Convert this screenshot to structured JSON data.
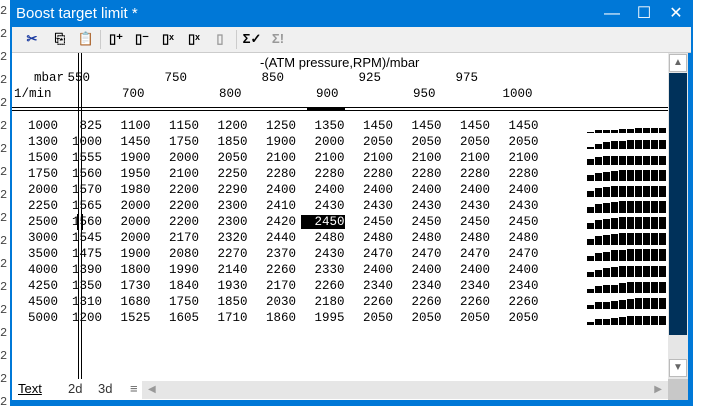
{
  "window": {
    "title": "Boost target limit  *",
    "minimize": "—",
    "maximize": "☐",
    "close": "✕"
  },
  "toolbar": [
    {
      "name": "cut-icon",
      "glyph": "✂"
    },
    {
      "name": "copy-icon",
      "glyph": "⎘"
    },
    {
      "name": "paste-icon",
      "glyph": "📋"
    },
    {
      "name": "insert-row-icon",
      "glyph": "▯⁺"
    },
    {
      "name": "delete-row-icon",
      "glyph": "▯⁻"
    },
    {
      "name": "fill-icon",
      "glyph": "▯ˣ"
    },
    {
      "name": "multiply-icon",
      "glyph": "▯ˣ"
    },
    {
      "name": "interpolate-icon",
      "glyph": "▯"
    },
    {
      "name": "sum-check-icon",
      "glyph": "Σ✓"
    },
    {
      "name": "sum-icon",
      "glyph": "Σ!"
    }
  ],
  "table": {
    "title": "-(ATM pressure,RPM)/mbar",
    "row_unit": "1/min",
    "col_unit": "mbar",
    "columns": [
      "550",
      "700",
      "750",
      "800",
      "850",
      "900",
      "925",
      "950",
      "975",
      "1000"
    ],
    "selected": {
      "row": 6,
      "col": 5
    },
    "rows": [
      {
        "label": "1000",
        "values": [
          825,
          1100,
          1150,
          1200,
          1250,
          1350,
          1450,
          1450,
          1450,
          1450
        ]
      },
      {
        "label": "1300",
        "values": [
          1000,
          1450,
          1750,
          1850,
          1900,
          2000,
          2050,
          2050,
          2050,
          2050
        ]
      },
      {
        "label": "1500",
        "values": [
          1555,
          1900,
          2000,
          2050,
          2100,
          2100,
          2100,
          2100,
          2100,
          2100
        ]
      },
      {
        "label": "1750",
        "values": [
          1560,
          1950,
          2100,
          2250,
          2280,
          2280,
          2280,
          2280,
          2280,
          2280
        ]
      },
      {
        "label": "2000",
        "values": [
          1570,
          1980,
          2200,
          2290,
          2400,
          2400,
          2400,
          2400,
          2400,
          2400
        ]
      },
      {
        "label": "2250",
        "values": [
          1565,
          2000,
          2200,
          2300,
          2410,
          2430,
          2430,
          2430,
          2430,
          2430
        ]
      },
      {
        "label": "2500",
        "values": [
          1560,
          2000,
          2200,
          2300,
          2420,
          2450,
          2450,
          2450,
          2450,
          2450
        ]
      },
      {
        "label": "3000",
        "values": [
          1545,
          2000,
          2170,
          2320,
          2440,
          2480,
          2480,
          2480,
          2480,
          2480
        ]
      },
      {
        "label": "3500",
        "values": [
          1475,
          1900,
          2080,
          2270,
          2370,
          2430,
          2470,
          2470,
          2470,
          2470
        ]
      },
      {
        "label": "4000",
        "values": [
          1390,
          1800,
          1990,
          2140,
          2260,
          2330,
          2400,
          2400,
          2400,
          2400
        ]
      },
      {
        "label": "4250",
        "values": [
          1350,
          1730,
          1840,
          1930,
          2170,
          2260,
          2340,
          2340,
          2340,
          2340
        ]
      },
      {
        "label": "4500",
        "values": [
          1310,
          1680,
          1750,
          1850,
          2030,
          2180,
          2260,
          2260,
          2260,
          2260
        ]
      },
      {
        "label": "5000",
        "values": [
          1200,
          1525,
          1605,
          1710,
          1860,
          1995,
          2050,
          2050,
          2050,
          2050
        ]
      }
    ]
  },
  "tabs": [
    {
      "label": "Text"
    },
    {
      "label": "2d"
    },
    {
      "label": "3d"
    },
    {
      "label": "≡"
    }
  ],
  "left_edge_chars": "2\n2\n2\n2\n2\n2\n2\n2\n2\n2\n2\n2\n2\n2\n2\n2\n2\n2"
}
